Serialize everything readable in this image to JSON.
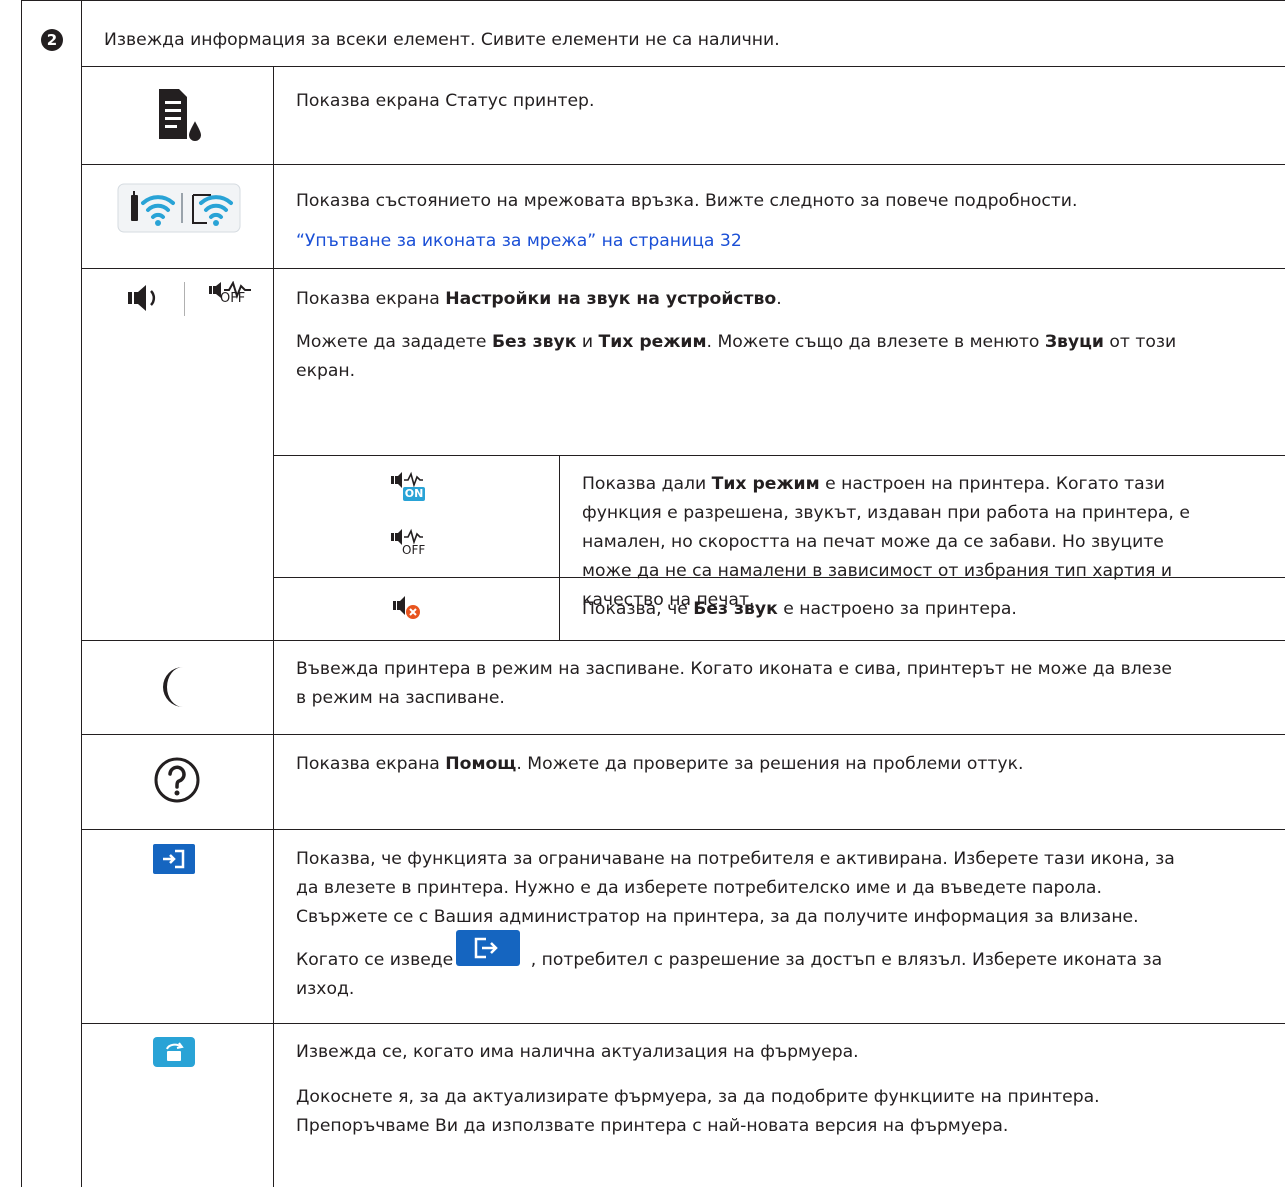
{
  "callout": {
    "number": "2"
  },
  "header": {
    "text": "Извежда информация за всеки елемент. Сивите елементи не са налични."
  },
  "rows": {
    "status": {
      "icon": "printer-status-ink-icon",
      "text": "Показва екрана Статус принтер."
    },
    "network": {
      "icon": "network-wifi-icon",
      "text": "Показва състоянието на мрежовата връзка. Вижте следното за повече подробности.",
      "link": "“Упътване за иконата за мрежа” на страница 32"
    },
    "sound": {
      "icon": "speaker-icon",
      "line1_pre": "Показва екрана ",
      "line1_bold": "Настройки на звук на устройство",
      "line1_post": ".",
      "line2_a": "Можете да зададете ",
      "line2_b": "Без звук",
      "line2_c": " и ",
      "line2_d": "Тих режим",
      "line2_e": ". Можете също да влезете в менюто ",
      "line2_f": "Звуци",
      "line2_g": " от този",
      "line3": "екран.",
      "quiet": {
        "on_label": "ON",
        "off_label": "OFF",
        "l1_a": "Показва дали ",
        "l1_b": "Тих режим",
        "l1_c": " е настроен на принтера. Когато тази",
        "l2": "функция е разрешена, звукът, издаван при работа на принтера, е",
        "l3": "намален, но скоростта на печат може да се забави. Но звуците",
        "l4": "може да не са намалени в зависимост от избрания тип хартия и",
        "l5": "качество на печат."
      },
      "mute": {
        "a": "Показва, че ",
        "b": "Без звук",
        "c": " е настроено за принтера."
      }
    },
    "sleep": {
      "icon": "moon-icon",
      "l1": "Въвежда принтера в режим на заспиване. Когато иконата е сива, принтерът не може да влезе",
      "l2": "в режим на заспиване."
    },
    "help": {
      "icon": "question-circle-icon",
      "a": "Показва екрана ",
      "b": "Помощ",
      "c": ". Можете да проверите за решения на проблеми оттук."
    },
    "login": {
      "icon": "login-icon",
      "l1": "Показва, че функцията за ограничаване на потребителя е активирана. Изберете тази икона, за",
      "l2": "да влезете в принтера. Нужно е да изберете потребителско име и да въведете парола.",
      "l3": "Свържете се с Вашия администратор на принтера, за да получите информация за влизане.",
      "l4_a": "Когато се изведе ",
      "l4_b": ", потребител с разрешение за достъп е влязъл. Изберете иконата за",
      "l5": "изход."
    },
    "firmware": {
      "icon": "firmware-update-icon",
      "l1": "Извежда се, когато има налична актуализация на фърмуера.",
      "l2": "Докоснете я, за да актуализирате фърмуера, за да подобрите функциите на принтера.",
      "l3": "Препоръчваме Ви да използвате принтера с най-новата версия на фърмуера."
    }
  },
  "colors": {
    "accent_blue": "#1565c0",
    "icon_light_blue": "#29a3d6",
    "link": "#1a4fd6",
    "off_orange": "#e8541e"
  }
}
